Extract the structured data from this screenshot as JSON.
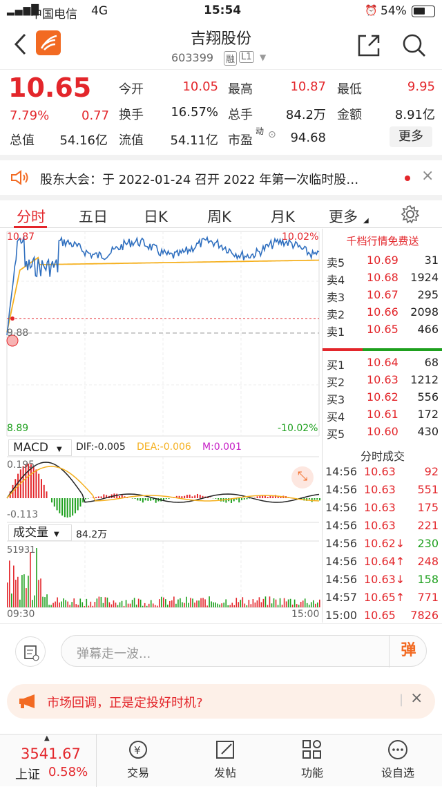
{
  "status_bar": {
    "carrier": "中国电信",
    "network": "4G",
    "time": "15:54",
    "battery": "54%"
  },
  "header": {
    "title": "吉翔股份",
    "code": "603399",
    "tag1": "融",
    "tag2": "L1"
  },
  "quote": {
    "price": "10.65",
    "change_pct": "7.79%",
    "change": "0.77",
    "open_label": "今开",
    "open": "10.05",
    "high_label": "最高",
    "high": "10.87",
    "low_label": "最低",
    "low": "9.95",
    "turnover_label": "换手",
    "turnover": "16.57%",
    "volume_label": "总手",
    "volume": "84.2万",
    "amount_label": "金额",
    "amount": "8.91亿",
    "mktcap_label": "总值",
    "mktcap": "54.16亿",
    "float_label": "流值",
    "float_cap": "54.11亿",
    "pe_label": "市盈",
    "pe_sup": "动",
    "pe": "94.68",
    "more_button": "更多"
  },
  "notice": {
    "text": "股东大会：于 2022-01-24 召开 2022 年第一次临时股…"
  },
  "tabs": [
    "分时",
    "五日",
    "日K",
    "周K",
    "月K",
    "更多"
  ],
  "chart": {
    "price_high": "10.87",
    "price_low": "8.89",
    "pct_high": "10.02%",
    "pct_low": "-10.02%",
    "prev_close": "9.88",
    "macd_label": "MACD",
    "dif": "DIF:-0.005",
    "dea": "DEA:-0.006",
    "m": "M:0.001",
    "macd_max": "0.195",
    "macd_min": "-0.113",
    "vol_label": "成交量",
    "vol_value": "84.2万",
    "vol_max": "51931",
    "time_start": "09:30",
    "time_end": "15:00",
    "colors": {
      "price_line": "#2f6fbf",
      "avg_line": "#f5b01f",
      "up": "#e3262b",
      "down": "#1ea01e",
      "dea": "#f5b01f",
      "dif": "#222"
    }
  },
  "orderbook": {
    "banner": "千档行情免费送",
    "asks": [
      {
        "label": "卖5",
        "price": "10.69",
        "vol": "31"
      },
      {
        "label": "卖4",
        "price": "10.68",
        "vol": "1924"
      },
      {
        "label": "卖3",
        "price": "10.67",
        "vol": "295"
      },
      {
        "label": "卖2",
        "price": "10.66",
        "vol": "2098"
      },
      {
        "label": "卖1",
        "price": "10.65",
        "vol": "466"
      }
    ],
    "bids": [
      {
        "label": "买1",
        "price": "10.64",
        "vol": "68"
      },
      {
        "label": "买2",
        "price": "10.63",
        "vol": "1212"
      },
      {
        "label": "买3",
        "price": "10.62",
        "vol": "556"
      },
      {
        "label": "买4",
        "price": "10.61",
        "vol": "172"
      },
      {
        "label": "买5",
        "price": "10.60",
        "vol": "430"
      }
    ],
    "trades_title": "分时成交",
    "trades": [
      {
        "time": "14:56",
        "price": "10.63",
        "vol": "92",
        "dir": ""
      },
      {
        "time": "14:56",
        "price": "10.63",
        "vol": "551",
        "dir": ""
      },
      {
        "time": "14:56",
        "price": "10.63",
        "vol": "175",
        "dir": ""
      },
      {
        "time": "14:56",
        "price": "10.63",
        "vol": "221",
        "dir": ""
      },
      {
        "time": "14:56",
        "price": "10.62↓",
        "vol": "230",
        "dir": "down"
      },
      {
        "time": "14:56",
        "price": "10.64↑",
        "vol": "248",
        "dir": "up"
      },
      {
        "time": "14:56",
        "price": "10.63↓",
        "vol": "158",
        "dir": "down"
      },
      {
        "time": "14:57",
        "price": "10.65↑",
        "vol": "771",
        "dir": "up"
      },
      {
        "time": "15:00",
        "price": "10.65",
        "vol": "7826",
        "dir": ""
      }
    ]
  },
  "danmu": {
    "placeholder": "弹幕走一波...",
    "button": "弹"
  },
  "promo": {
    "text": "市场回调，正是定投好时机?"
  },
  "bottom_nav": {
    "index_value": "3541.67",
    "index_name": "上证",
    "index_pct": "0.58%",
    "items": [
      "交易",
      "发帖",
      "功能",
      "设自选"
    ]
  }
}
